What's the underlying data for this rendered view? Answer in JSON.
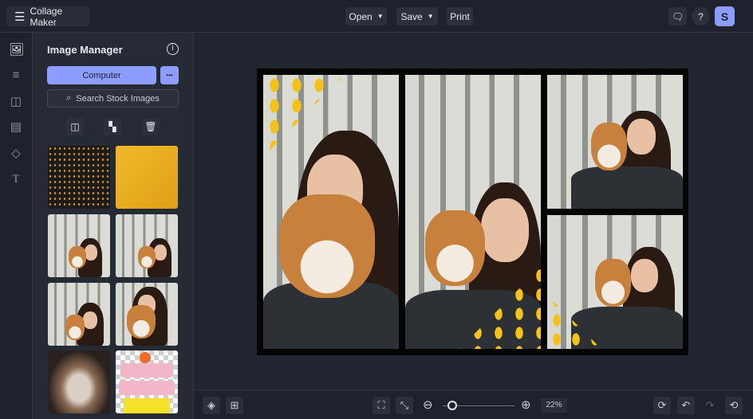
{
  "app": {
    "title": "Collage Maker"
  },
  "toolbar": {
    "open": "Open",
    "save": "Save",
    "print": "Print",
    "avatar": "S"
  },
  "panel": {
    "title": "Image Manager",
    "computer": "Computer",
    "more": "•••",
    "search": "Search Stock Images"
  },
  "zoom": {
    "value": "22%",
    "level": 0.22
  },
  "colors": {
    "accent": "#8c9cff",
    "bg": "#22252f",
    "panel": "#262a35"
  }
}
